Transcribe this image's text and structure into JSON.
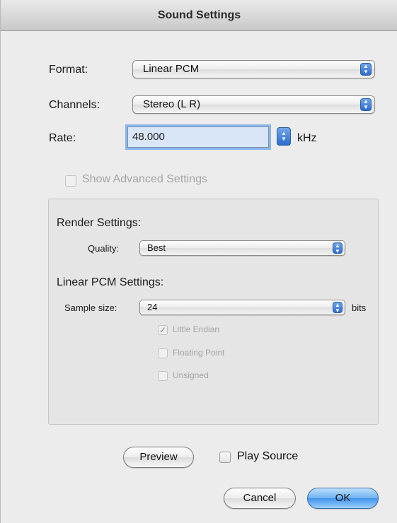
{
  "window": {
    "title": "Sound Settings"
  },
  "format": {
    "label": "Format:",
    "value": "Linear PCM"
  },
  "channels": {
    "label": "Channels:",
    "value": "Stereo (L R)"
  },
  "rate": {
    "label": "Rate:",
    "value": "48.000",
    "unit": "kHz"
  },
  "advanced": {
    "label": "Show Advanced Settings",
    "checked": false,
    "enabled": false
  },
  "render": {
    "title": "Render Settings:",
    "quality_label": "Quality:",
    "quality_value": "Best"
  },
  "pcm": {
    "title": "Linear PCM Settings:",
    "sample_size_label": "Sample size:",
    "sample_size_value": "24",
    "sample_size_unit": "bits",
    "options": [
      {
        "label": "Little Endian",
        "checked": true
      },
      {
        "label": "Floating Point",
        "checked": false
      },
      {
        "label": "Unsigned",
        "checked": false
      }
    ]
  },
  "footer": {
    "preview_label": "Preview",
    "play_source_label": "Play Source",
    "cancel_label": "Cancel",
    "ok_label": "OK"
  },
  "icons": {
    "stepper": "up-down-arrows-icon",
    "checkmark": "checkmark-icon"
  },
  "colors": {
    "accent": "#3f93ea",
    "focus_ring": "#8cb5ea"
  }
}
